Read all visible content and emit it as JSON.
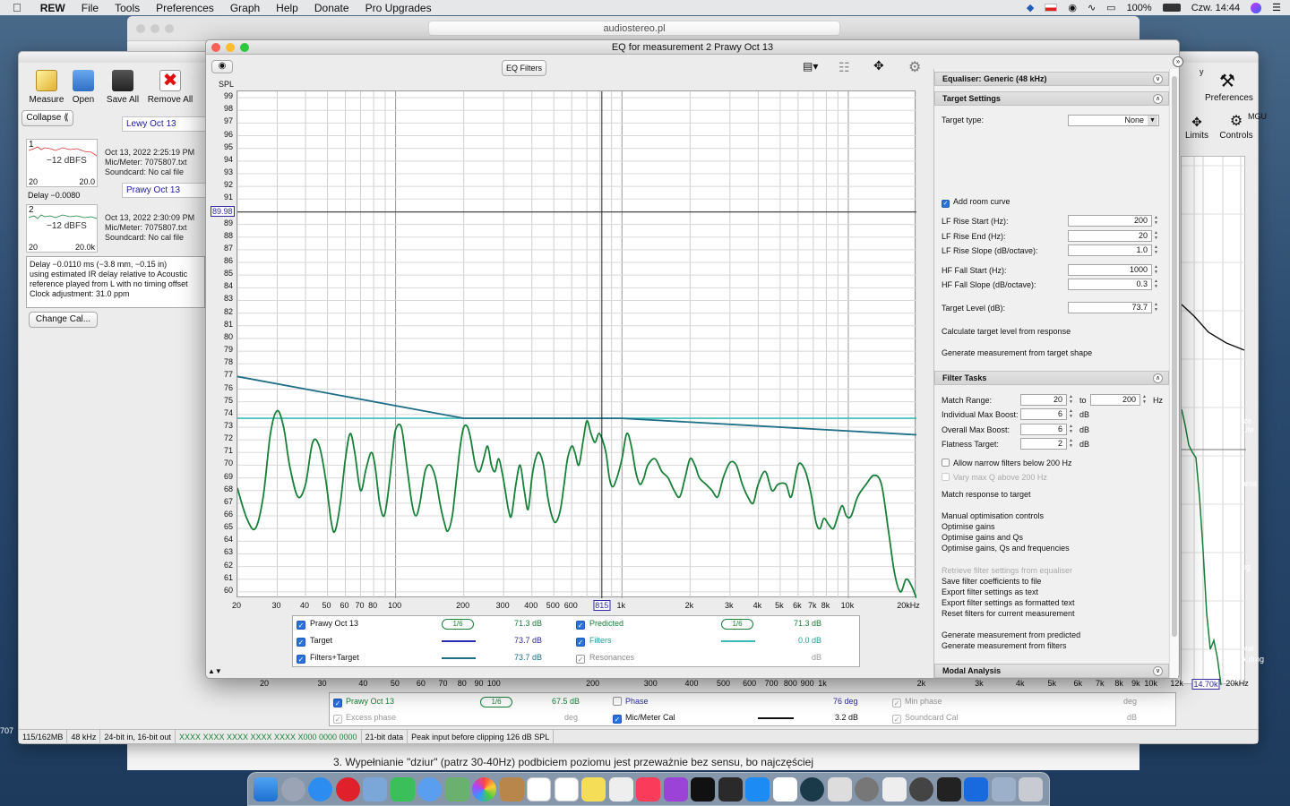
{
  "menubar": {
    "apple": "",
    "app": "REW",
    "items": [
      "File",
      "Tools",
      "Preferences",
      "Graph",
      "Help",
      "Donate",
      "Pro Upgrades"
    ],
    "battery": "100%",
    "clock": "Czw. 14:44"
  },
  "browser": {
    "url": "audiostereo.pl",
    "post_text": "3. Wypełnianie \"dziur\" (patrz 30-40Hz) podbiciem poziomu jest przeważnie bez sensu, bo najczęściej"
  },
  "rew": {
    "toolbar": [
      {
        "label": "Measure",
        "icon": "measure-icon"
      },
      {
        "label": "Open",
        "icon": "open-folder-icon"
      },
      {
        "label": "Save All",
        "icon": "save-icon"
      },
      {
        "label": "Remove All",
        "icon": "remove-icon"
      }
    ],
    "collapse_label": "Collapse",
    "right_tools": [
      {
        "label": "Preferences",
        "icon": "preferences-icon"
      },
      {
        "label": "Limits",
        "icon": "limits-icon"
      },
      {
        "label": "Controls",
        "icon": "controls-icon"
      }
    ],
    "partial_labels": {
      "mgu": "MGU",
      "ze_life": "ze Life",
      "ania": "ania",
      "og": "og",
      "otal": "otal",
      "admg": "A.dmg",
      "y": "y",
      "e7075": "707"
    },
    "measurements": [
      {
        "num": "1",
        "name": "Lewy Oct 13",
        "level": "−12 dBFS",
        "x_start": "20",
        "x_end": "20.0",
        "date": "Oct 13, 2022 2:25:19 PM",
        "mic": "Mic/Meter: 7075807.txt",
        "card": "Soundcard: No cal file",
        "delay": "Delay −0.0080"
      },
      {
        "num": "2",
        "name": "Prawy Oct 13",
        "level": "−12 dBFS",
        "x_start": "20",
        "x_end": "20.0k",
        "date": "Oct 13, 2022 2:30:09 PM",
        "mic": "Mic/Meter: 7075807.txt",
        "card": "Soundcard: No cal file"
      }
    ],
    "notes": [
      "Delay −0.0110 ms (−3.8 mm, −0.15 in)",
      "using estimated IR delay relative to Acoustic",
      "reference played from  L with no timing offset",
      "Clock adjustment: 31.0 ppm"
    ],
    "change_cal_label": "Change Cal...",
    "bottom_x": [
      "20",
      "30",
      "40",
      "50",
      "60",
      "70",
      "80",
      "90",
      "100",
      "200",
      "300",
      "400",
      "500",
      "600",
      "700",
      "800",
      "900",
      "1k",
      "2k",
      "3k",
      "4k",
      "5k",
      "6k",
      "7k",
      "8k",
      "9k",
      "10k",
      "12k",
      "14.70k",
      "20kHz"
    ],
    "bottom_legend": [
      {
        "label": "Prawy Oct 13",
        "checked": true,
        "value": "67.5 dB",
        "smoothing": "1/6"
      },
      {
        "label": "Phase",
        "checked": false,
        "value": "76 deg"
      },
      {
        "label": "Min phase",
        "checked": true,
        "dim": true,
        "value": "deg"
      },
      {
        "label": "Excess phase",
        "checked": true,
        "dim": true,
        "value": "deg"
      },
      {
        "label": "Mic/Meter Cal",
        "checked": true,
        "value": "3.2 dB"
      },
      {
        "label": "Soundcard Cal",
        "checked": true,
        "dim": true,
        "value": "dB"
      }
    ],
    "status": [
      "115/162MB",
      "48 kHz",
      "24-bit in, 16-bit out",
      "XXXX XXXX  XXXX XXXX  XXXX X000  0000 0000",
      "21-bit data",
      "Peak input before clipping 126 dB SPL"
    ]
  },
  "eq": {
    "title": "EQ for measurement 2 Prawy Oct 13",
    "eq_filters_btn": "EQ Filters",
    "y_axis_label": "SPL",
    "cursor_y": "89.98",
    "cursor_x": "815",
    "y_ticks": [
      "99",
      "98",
      "97",
      "96",
      "95",
      "94",
      "93",
      "92",
      "91",
      "90",
      "89",
      "88",
      "87",
      "86",
      "85",
      "84",
      "83",
      "82",
      "81",
      "80",
      "79",
      "78",
      "77",
      "76",
      "75",
      "74",
      "73",
      "72",
      "71",
      "70",
      "69",
      "68",
      "67",
      "66",
      "65",
      "64",
      "63",
      "62",
      "61",
      "60"
    ],
    "x_ticks": [
      "20",
      "30",
      "40",
      "50",
      "60",
      "70",
      "80",
      "100",
      "200",
      "300",
      "400",
      "500",
      "600",
      "1k",
      "2k",
      "3k",
      "4k",
      "5k",
      "6k",
      "7k",
      "8k",
      "10k",
      "20kHz"
    ],
    "legend": [
      {
        "label": "Prawy Oct 13",
        "checked": true,
        "smoothing": "1/6",
        "value": "71.3 dB",
        "color": "#19803a"
      },
      {
        "label": "Target",
        "checked": true,
        "value": "73.7 dB",
        "color": "#2c2cb0"
      },
      {
        "label": "Filters+Target",
        "checked": true,
        "value": "73.7 dB",
        "color": "#1f6e88"
      },
      {
        "label": "Predicted",
        "checked": true,
        "smoothing": "1/6",
        "value": "71.3 dB",
        "color": "#19803a"
      },
      {
        "label": "Filters",
        "checked": true,
        "value": "0.0 dB",
        "color": "#3cbcb8"
      },
      {
        "label": "Resonances",
        "checked": true,
        "dim": true,
        "value": "dB"
      }
    ],
    "panel": {
      "equaliser_header": "Equaliser: Generic (48 kHz)",
      "target_header": "Target Settings",
      "target_type_label": "Target type:",
      "target_type_value": "None",
      "add_room_curve": "Add room curve",
      "lf_rise_start_label": "LF Rise Start (Hz):",
      "lf_rise_start": "200",
      "lf_rise_end_label": "LF Rise End (Hz):",
      "lf_rise_end": "20",
      "lf_rise_slope_label": "LF Rise Slope (dB/octave):",
      "lf_rise_slope": "1.0",
      "hf_fall_start_label": "HF Fall Start (Hz):",
      "hf_fall_start": "1000",
      "hf_fall_slope_label": "HF Fall Slope (dB/octave):",
      "hf_fall_slope": "0.3",
      "target_level_label": "Target Level (dB):",
      "target_level": "73.7",
      "calc_target": "Calculate target level from response",
      "gen_meas_target": "Generate measurement from target shape",
      "filter_tasks_header": "Filter Tasks",
      "match_range_label": "Match Range:",
      "match_from": "20",
      "to_label": "to",
      "match_to": "200",
      "hz_label": "Hz",
      "indiv_boost_label": "Individual Max Boost:",
      "indiv_boost": "6",
      "db1": "dB",
      "overall_boost_label": "Overall Max Boost:",
      "overall_boost": "6",
      "db2": "dB",
      "flatness_label": "Flatness Target:",
      "flatness": "2",
      "db3": "dB",
      "allow_narrow": "Allow narrow filters below 200 Hz",
      "vary_q": "Vary max Q above 200 Hz",
      "match_response": "Match response to target",
      "manual_opt": "Manual optimisation controls",
      "opt_gains": "Optimise gains",
      "opt_gains_qs": "Optimise gains and Qs",
      "opt_gains_qs_f": "Optimise gains, Qs and frequencies",
      "retrieve": "Retrieve filter settings from equaliser",
      "save_coeffs": "Save filter coefficients to file",
      "export_text": "Export filter settings as text",
      "export_formatted": "Export filter settings as formatted text",
      "reset_filters": "Reset filters for current measurement",
      "gen_predicted": "Generate measurement from predicted",
      "gen_filters": "Generate measurement from filters",
      "modal_header": "Modal Analysis"
    }
  },
  "chart_data": {
    "type": "line",
    "title": "",
    "xlabel": "",
    "ylabel": "SPL",
    "x_scale": "log",
    "xlim": [
      20,
      20000
    ],
    "ylim": [
      59.5,
      99.5
    ],
    "series": [
      {
        "name": "Prawy Oct 13",
        "points": [
          [
            20,
            68.2
          ],
          [
            22,
            65.8
          ],
          [
            24,
            65
          ],
          [
            26,
            67.5
          ],
          [
            28,
            72.5
          ],
          [
            30,
            74.3
          ],
          [
            32,
            73
          ],
          [
            34,
            70
          ],
          [
            37,
            67.5
          ],
          [
            40,
            68.5
          ],
          [
            43,
            71.8
          ],
          [
            46,
            71.5
          ],
          [
            49,
            69
          ],
          [
            52,
            65.5
          ],
          [
            54,
            64.8
          ],
          [
            57,
            67
          ],
          [
            60,
            70.5
          ],
          [
            63,
            72.5
          ],
          [
            66,
            71
          ],
          [
            70,
            68
          ],
          [
            74,
            69.7
          ],
          [
            78,
            71
          ],
          [
            81,
            70
          ],
          [
            85,
            67
          ],
          [
            89,
            66
          ],
          [
            93,
            68
          ],
          [
            97,
            71
          ],
          [
            100,
            72.8
          ],
          [
            106,
            73
          ],
          [
            112,
            70
          ],
          [
            118,
            67
          ],
          [
            123,
            66
          ],
          [
            128,
            67
          ],
          [
            135,
            69.5
          ],
          [
            142,
            70
          ],
          [
            150,
            69
          ],
          [
            157,
            67
          ],
          [
            164,
            65.5
          ],
          [
            170,
            64.8
          ],
          [
            178,
            66
          ],
          [
            186,
            69
          ],
          [
            193,
            71.5
          ],
          [
            200,
            73
          ],
          [
            208,
            73
          ],
          [
            215,
            72
          ],
          [
            225,
            70
          ],
          [
            235,
            69.5
          ],
          [
            245,
            70.5
          ],
          [
            255,
            71.5
          ],
          [
            265,
            70
          ],
          [
            275,
            69.5
          ],
          [
            285,
            70.5
          ],
          [
            295,
            69.5
          ],
          [
            305,
            68
          ],
          [
            315,
            66.5
          ],
          [
            325,
            66
          ],
          [
            340,
            68.5
          ],
          [
            355,
            70
          ],
          [
            370,
            68
          ],
          [
            385,
            66.5
          ],
          [
            400,
            69
          ],
          [
            415,
            70.5
          ],
          [
            430,
            71
          ],
          [
            450,
            70
          ],
          [
            470,
            67.5
          ],
          [
            490,
            66
          ],
          [
            510,
            65.5
          ],
          [
            535,
            66.5
          ],
          [
            555,
            68.5
          ],
          [
            575,
            70.5
          ],
          [
            600,
            71.5
          ],
          [
            620,
            71
          ],
          [
            645,
            70
          ],
          [
            675,
            72
          ],
          [
            700,
            73.5
          ],
          [
            730,
            72.5
          ],
          [
            760,
            71.8
          ],
          [
            790,
            72.5
          ],
          [
            820,
            72
          ],
          [
            850,
            71
          ],
          [
            880,
            69
          ],
          [
            910,
            68.3
          ],
          [
            950,
            69
          ],
          [
            1000,
            70.5
          ],
          [
            1050,
            72.5
          ],
          [
            1100,
            71.5
          ],
          [
            1150,
            69.5
          ],
          [
            1200,
            68.5
          ],
          [
            1250,
            69
          ],
          [
            1300,
            70
          ],
          [
            1400,
            70.5
          ],
          [
            1500,
            69.5
          ],
          [
            1600,
            69
          ],
          [
            1700,
            68
          ],
          [
            1800,
            67.5
          ],
          [
            1900,
            69
          ],
          [
            2000,
            70.5
          ],
          [
            2100,
            70
          ],
          [
            2200,
            69
          ],
          [
            2350,
            68.5
          ],
          [
            2500,
            68
          ],
          [
            2650,
            67.5
          ],
          [
            2800,
            69
          ],
          [
            3000,
            70.2
          ],
          [
            3200,
            70
          ],
          [
            3400,
            68.5
          ],
          [
            3600,
            67.5
          ],
          [
            3800,
            67
          ],
          [
            4000,
            68.5
          ],
          [
            4300,
            69.5
          ],
          [
            4600,
            68
          ],
          [
            4900,
            68.5
          ],
          [
            5300,
            68.5
          ],
          [
            5600,
            67.5
          ],
          [
            6000,
            70
          ],
          [
            6400,
            69.7
          ],
          [
            6800,
            68
          ],
          [
            7200,
            65.5
          ],
          [
            7500,
            65
          ],
          [
            7800,
            65.8
          ],
          [
            8200,
            65.3
          ],
          [
            8600,
            65
          ],
          [
            9000,
            66
          ],
          [
            9400,
            66.8
          ],
          [
            9800,
            66
          ],
          [
            10300,
            66
          ],
          [
            11000,
            67.5
          ],
          [
            12000,
            68.5
          ],
          [
            13000,
            69.2
          ],
          [
            14000,
            68.5
          ],
          [
            15000,
            65
          ],
          [
            16000,
            61.5
          ],
          [
            17000,
            60
          ],
          [
            18000,
            61
          ],
          [
            19000,
            60.5
          ],
          [
            20000,
            59.5
          ]
        ]
      },
      {
        "name": "Target",
        "points": [
          [
            20,
            77
          ],
          [
            200,
            73.7
          ],
          [
            1000,
            73.7
          ],
          [
            20000,
            72.4
          ]
        ]
      },
      {
        "name": "Filters+Target",
        "points": [
          [
            20,
            77
          ],
          [
            200,
            73.7
          ],
          [
            1000,
            73.7
          ],
          [
            20000,
            72.4
          ]
        ]
      },
      {
        "name": "Filters",
        "points": [
          [
            20,
            73.7
          ],
          [
            20000,
            73.7
          ]
        ]
      }
    ],
    "colors": {
      "measurement": "#19803a",
      "target": "#1f6e88",
      "filters": "#3cbcb8",
      "cursor": "#222222"
    },
    "grid": true
  }
}
